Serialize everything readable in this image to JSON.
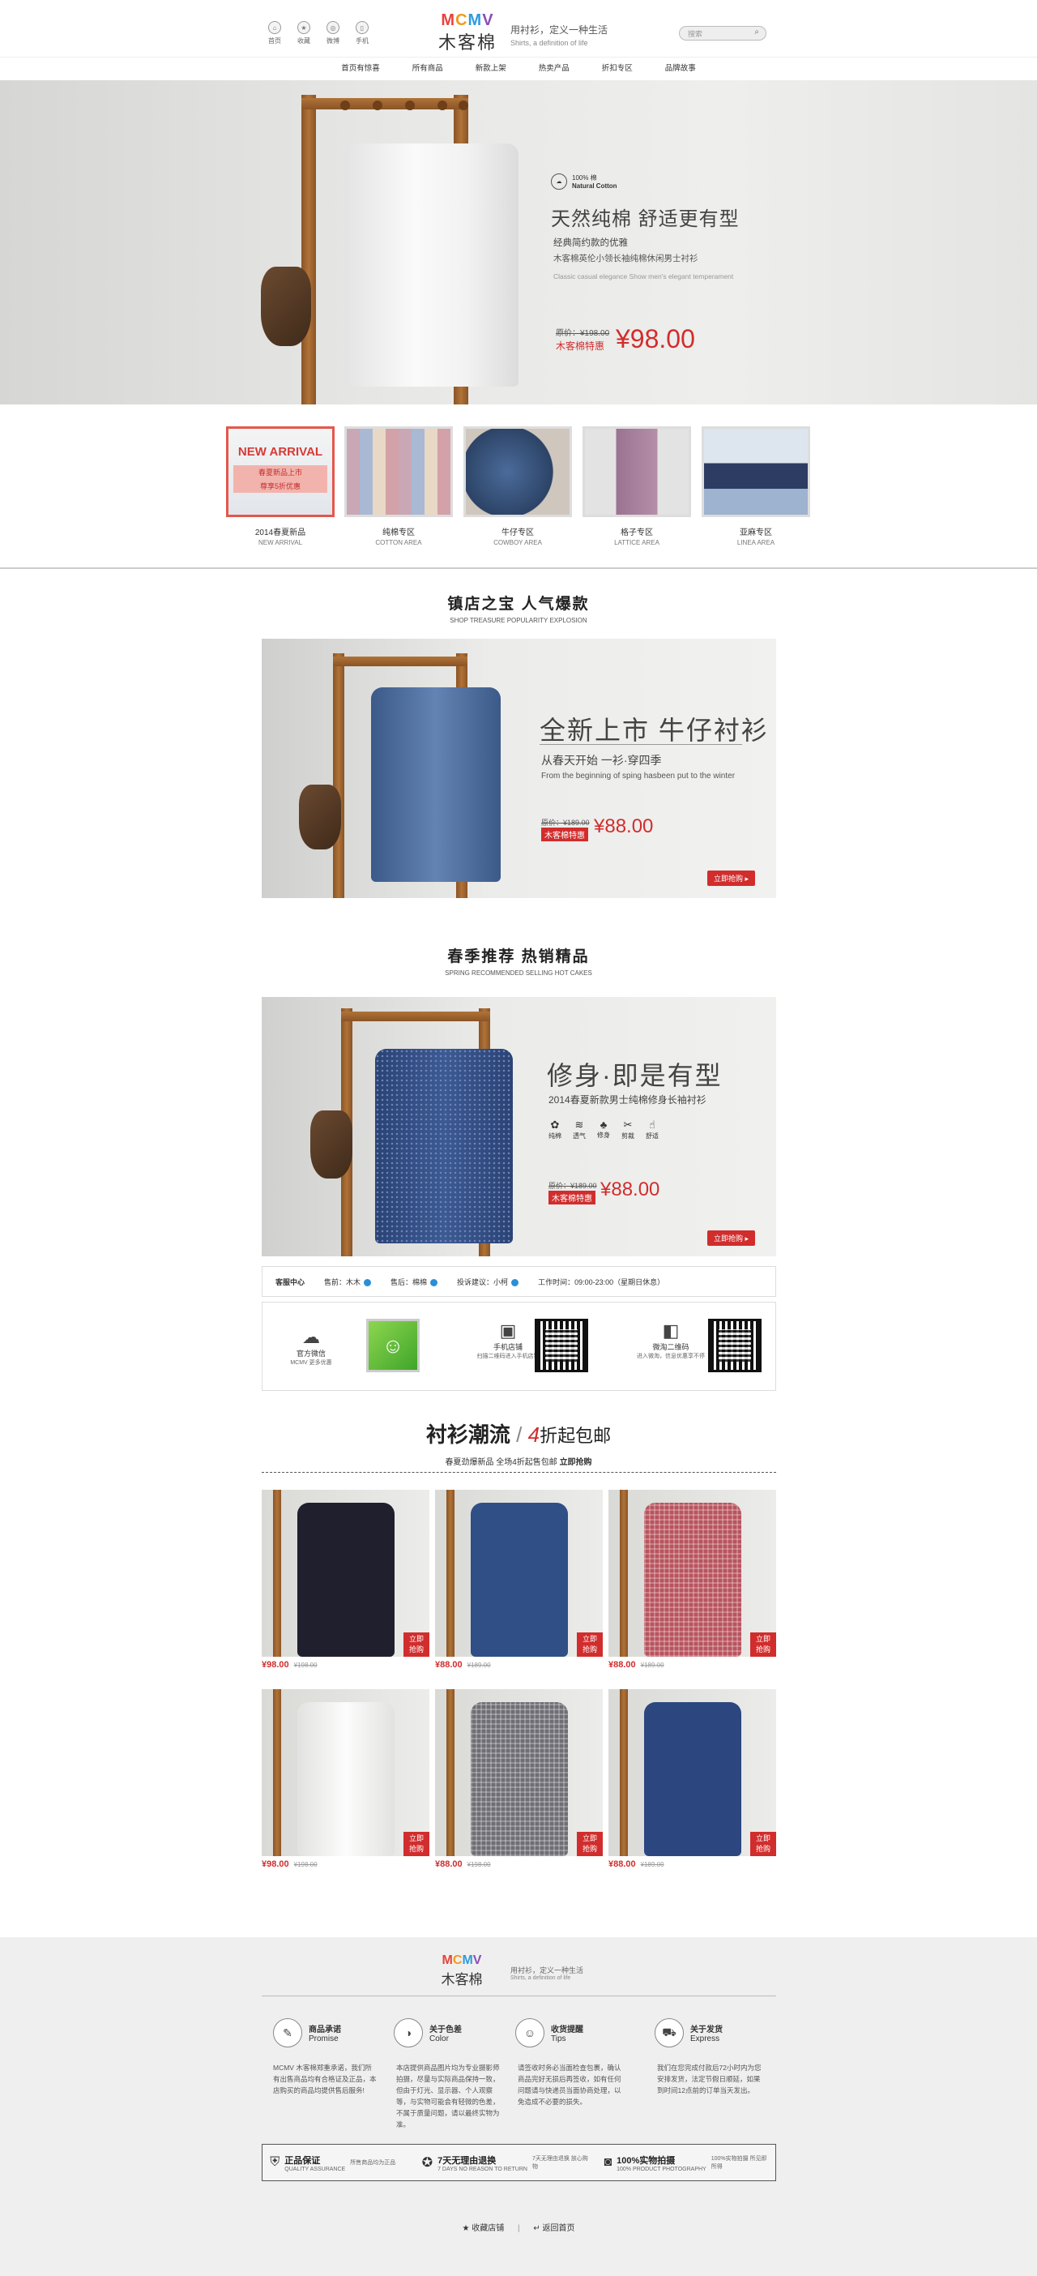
{
  "header": {
    "icons": [
      {
        "label": "首页",
        "glyph": "⌂"
      },
      {
        "label": "收藏",
        "glyph": "★"
      },
      {
        "label": "微博",
        "glyph": "◎"
      },
      {
        "label": "手机",
        "glyph": "▯"
      }
    ],
    "logo_en": "MCMV",
    "logo_cn": "木客棉",
    "slogan": "用衬衫，定义一种生活",
    "slogan_en": "Shirts, a definition of life",
    "search_placeholder": "搜索",
    "nav": [
      "首页有惊喜",
      "所有商品",
      "新款上架",
      "热卖产品",
      "折扣专区",
      "品牌故事"
    ]
  },
  "hero": {
    "badge": "100% 棉",
    "badge_sub": "Natural Cotton",
    "title": "天然纯棉  舒适更有型",
    "sub1": "经典简约款的优雅",
    "sub2": "木客棉英伦小领长袖纯棉休闲男士衬衫",
    "sub3": "Classic casual elegance  Show men's elegant temperament",
    "orig": "原价：¥198.00",
    "special": "木客棉特惠",
    "price": "¥98.00"
  },
  "categories": [
    {
      "label": "2014春夏新品",
      "en": "NEW ARRIVAL",
      "tile_title": "NEW ARRIVAL",
      "tile_sub1": "春夏新品上市",
      "tile_sub2": "尊享5折优惠"
    },
    {
      "label": "纯棉专区",
      "en": "COTTON AREA"
    },
    {
      "label": "牛仔专区",
      "en": "COWBOY AREA"
    },
    {
      "label": "格子专区",
      "en": "LATTICE AREA"
    },
    {
      "label": "亚麻专区",
      "en": "LINEA AREA"
    }
  ],
  "section1": {
    "title": "镇店之宝  人气爆款",
    "en": "SHOP TREASURE POPULARITY EXPLOSION"
  },
  "banner1": {
    "title": "全新上市 牛仔衬衫",
    "sub1": "从春天开始  一衫·穿四季",
    "sub2": "From the beginning of sping hasbeen put to the winter",
    "orig": "原价：¥189.00",
    "special": "木客棉特惠",
    "price": "¥88.00",
    "btn": "立即抢购 ▸"
  },
  "section2": {
    "title": "春季推荐  热销精品",
    "en": "SPRING RECOMMENDED SELLING HOT CAKES"
  },
  "banner2": {
    "title": "修身·即是有型",
    "sub1": "2014春夏新款男士纯棉修身长袖衬衫",
    "features": [
      {
        "g": "✿",
        "t": "纯棉"
      },
      {
        "g": "≋",
        "t": "透气"
      },
      {
        "g": "♣",
        "t": "修身"
      },
      {
        "g": "✂",
        "t": "剪裁"
      },
      {
        "g": "☝",
        "t": "舒适"
      }
    ],
    "orig": "原价：¥189.00",
    "special": "木客棉特惠",
    "price": "¥88.00",
    "btn": "立即抢购 ▸"
  },
  "service": {
    "label": "客服中心",
    "items": [
      "售前：木木",
      "售后：棉棉",
      "投诉建议：小柯",
      "工作时间：09:00-23:00（星期日休息）"
    ]
  },
  "qr": [
    {
      "t1": "官方微信",
      "t2": "MCMV 更多优惠"
    },
    {
      "t1": "手机店铺",
      "t2": "扫描二维码进入手机店铺"
    },
    {
      "t1": "微淘二维码",
      "t2": "进入微淘，信息优惠享不停"
    }
  ],
  "promo": {
    "title_a": "衬衫潮流",
    "title_b": "4",
    "title_c": "折起包邮",
    "sub": "春夏劲爆新品 全场4折起售包邮",
    "sub_b": "立即抢购"
  },
  "products": [
    {
      "price": "¥98.00",
      "orig": "¥198.00",
      "color": "#1f1f2e"
    },
    {
      "price": "¥88.00",
      "orig": "¥189.00",
      "color": "#2f4f86"
    },
    {
      "price": "¥88.00",
      "orig": "¥189.00",
      "color": "#b8545e"
    },
    {
      "price": "¥98.00",
      "orig": "¥198.00",
      "color": "#f4f4f2"
    },
    {
      "price": "¥88.00",
      "orig": "¥198.00",
      "color": "#6f6e74"
    },
    {
      "price": "¥88.00",
      "orig": "¥189.00",
      "color": "#2c4780"
    }
  ],
  "product_btn": "立即\n抢购",
  "footer": {
    "logo_en": "MCMV",
    "logo_cn": "木客棉",
    "slogan": "用衬衫，定义一种生活",
    "slogan_en": "Shirts, a definition of life",
    "features": [
      {
        "t1": "商品承诺",
        "t2": "Promise",
        "text": "MCMV 木客棉郑重承诺，我们所有出售商品均有合格证及正品，本店购买的商品均提供售后服务!"
      },
      {
        "t1": "关于色差",
        "t2": "Color",
        "text": "本店提供商品图片均为专业摄影师拍摄，尽量与实际商品保持一致，但由于灯光、显示器、个人观察等，与实物可能会有轻微的色差，不属于质量问题，请以最终实物为准。"
      },
      {
        "t1": "收货提醒",
        "t2": "Tips",
        "text": "请签收时务必当面检查包裹，确认商品完好无损后再签收，如有任何问题请与快递员当面协商处理，以免造成不必要的损失。"
      },
      {
        "t1": "关于发货",
        "t2": "Express",
        "text": "我们在您完成付款后72小时内为您安排发货，法定节假日顺延，如果到时间12点前的订单当天发出。"
      }
    ],
    "guarantees": [
      {
        "g1": "正品保证",
        "g2": "QUALITY ASSURANCE",
        "g3": "所售商品均为正品"
      },
      {
        "g1": "7天无理由退换",
        "g2": "7 DAYS NO REASON TO RETURN",
        "g3": "7天无理由退换 放心购物"
      },
      {
        "g1": "100%实物拍摄",
        "g2": "100% PRODUCT PHOTOGRAPHY",
        "g3": "100%实物拍摄 所见即所得"
      }
    ],
    "links": [
      "收藏店铺",
      "返回首页"
    ]
  }
}
